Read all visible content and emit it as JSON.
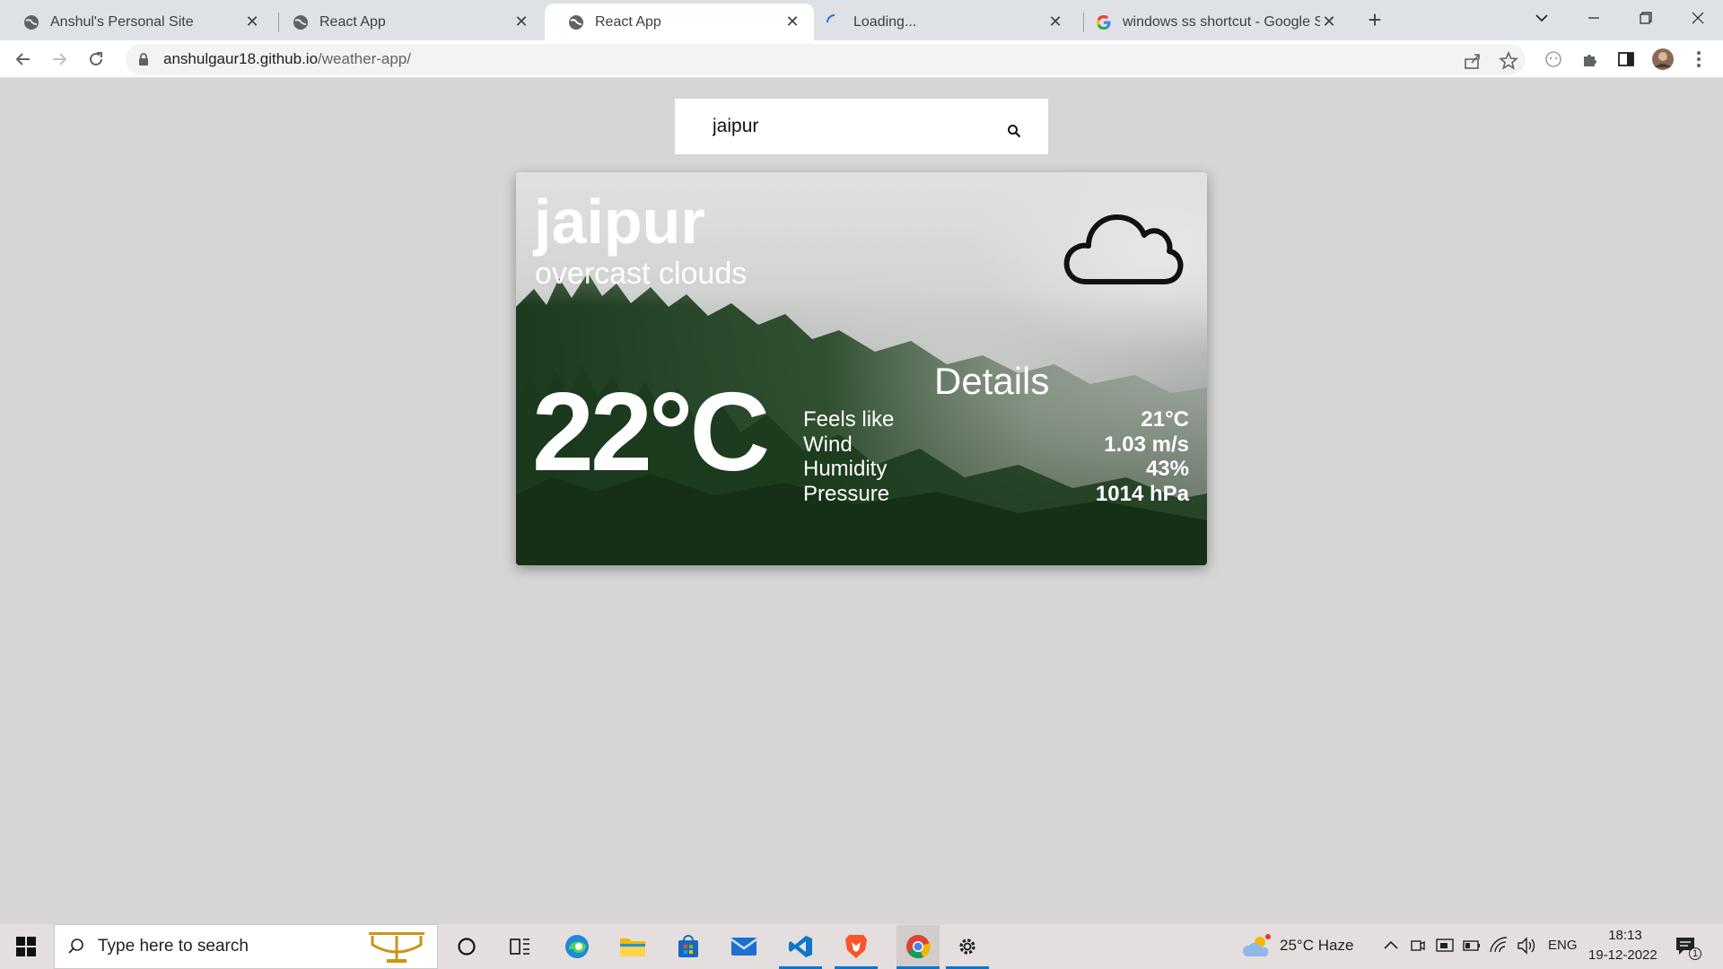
{
  "browser": {
    "tabs": [
      {
        "title": "Anshul's Personal Site",
        "icon": "globe-icon",
        "active": false
      },
      {
        "title": "React App",
        "icon": "globe-icon",
        "active": false
      },
      {
        "title": "React App",
        "icon": "globe-icon",
        "active": true
      },
      {
        "title": "Loading...",
        "icon": "loading-spinner-icon",
        "active": false
      },
      {
        "title": "windows ss shortcut - Google Se",
        "icon": "google-icon",
        "active": false
      }
    ],
    "url_host": "anshulgaur18.github.io",
    "url_path": "/weather-app/"
  },
  "search": {
    "value": "jaipur"
  },
  "weather": {
    "city": "jaipur",
    "description": "overcast clouds",
    "temperature": "22°C",
    "condition_icon": "cloud-icon",
    "details_title": "Details",
    "details": [
      {
        "label": "Feels like",
        "value": "21°C"
      },
      {
        "label": "Wind",
        "value": "1.03 m/s"
      },
      {
        "label": "Humidity",
        "value": "43%"
      },
      {
        "label": "Pressure",
        "value": "1014 hPa"
      }
    ]
  },
  "taskbar": {
    "search_placeholder": "Type here to search",
    "weather_widget": "25°C  Haze",
    "language": "ENG",
    "time": "18:13",
    "date": "19-12-2022",
    "notification_count": "1"
  },
  "colors": {
    "page_background": "#d6d6d6",
    "tab_strip": "#dee1e6",
    "accent": "#0078d4"
  }
}
